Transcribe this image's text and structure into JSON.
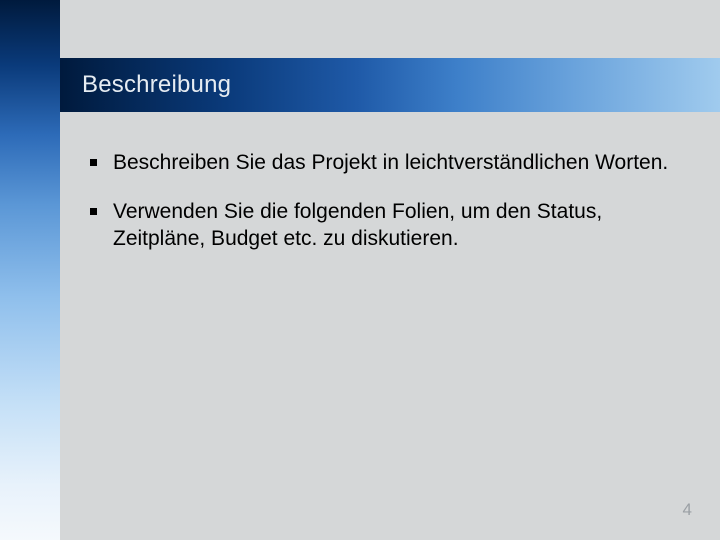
{
  "slide": {
    "title": "Beschreibung",
    "bullets": [
      {
        "text": "Beschreiben Sie das Projekt in leichtverständlichen Worten."
      },
      {
        "text": "Verwenden Sie die folgenden Folien, um den Status, Zeitpläne, Budget etc. zu diskutieren."
      }
    ],
    "page_number": "4"
  }
}
